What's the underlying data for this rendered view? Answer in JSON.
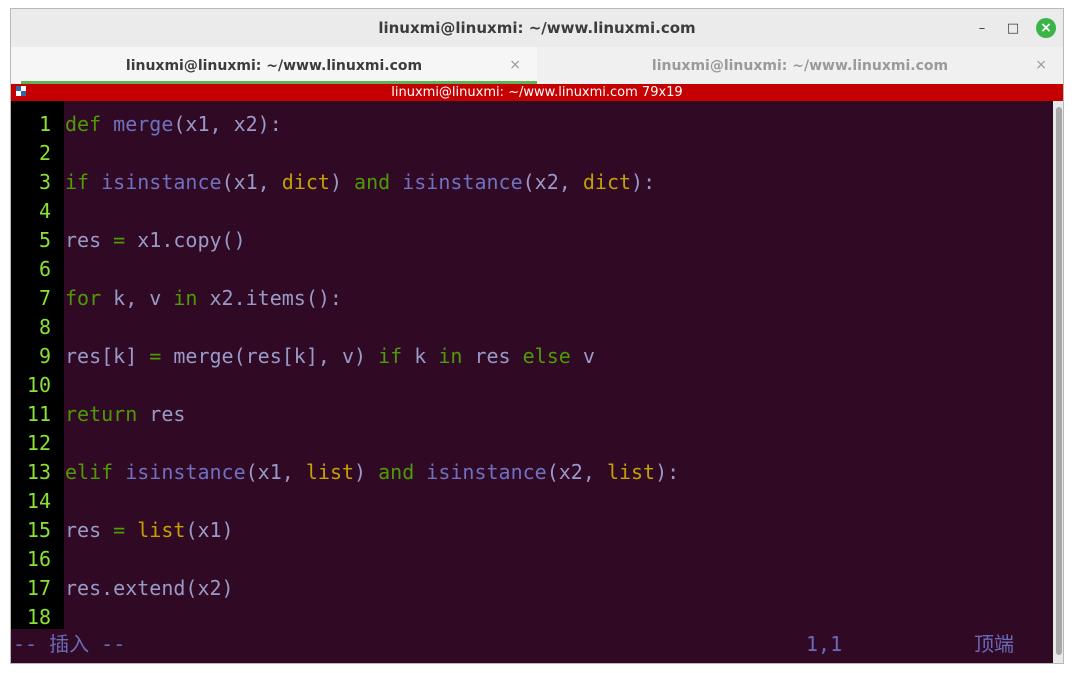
{
  "window": {
    "title": "linuxmi@linuxmi: ~/www.linuxmi.com"
  },
  "window_controls": {
    "minimize": "–",
    "maximize": "□",
    "close": "×"
  },
  "tabs": [
    {
      "label": "linuxmi@linuxmi: ~/www.linuxmi.com",
      "close": "×",
      "active": true
    },
    {
      "label": "linuxmi@linuxmi: ~/www.linuxmi.com",
      "close": "×",
      "active": false
    }
  ],
  "statusline": {
    "text": "linuxmi@linuxmi: ~/www.linuxmi.com 79x19"
  },
  "editor": {
    "lines": [
      {
        "num": "1"
      },
      {
        "num": "2"
      },
      {
        "num": "3"
      },
      {
        "num": "4"
      },
      {
        "num": "5"
      },
      {
        "num": "6"
      },
      {
        "num": "7"
      },
      {
        "num": "8"
      },
      {
        "num": "9"
      },
      {
        "num": "10"
      },
      {
        "num": "11"
      },
      {
        "num": "12"
      },
      {
        "num": "13"
      },
      {
        "num": "14"
      },
      {
        "num": "15"
      },
      {
        "num": "16"
      },
      {
        "num": "17"
      },
      {
        "num": "18"
      }
    ],
    "code": {
      "l1": [
        "def",
        "merge",
        "(x1, x2):"
      ],
      "l3": [
        "if",
        "isinstance",
        "(x1, ",
        "dict",
        ") ",
        "and",
        "isinstance",
        "(x2, ",
        "dict",
        "):"
      ],
      "l5": [
        "res ",
        "=",
        " x1.copy()"
      ],
      "l7": [
        "for",
        " k, v ",
        "in",
        " x2.items():"
      ],
      "l9": [
        "res[k] ",
        "=",
        " merge(res[k], v) ",
        "if",
        " k ",
        "in",
        " res ",
        "else",
        " v"
      ],
      "l11": [
        "return",
        " res"
      ],
      "l13": [
        "elif",
        "isinstance",
        "(x1, ",
        "list",
        ") ",
        "and",
        "isinstance",
        "(x2, ",
        "list",
        "):"
      ],
      "l15": [
        "res ",
        "=",
        " ",
        "list",
        "(x1)"
      ],
      "l17": [
        "res.extend(x2)"
      ]
    }
  },
  "cmdline": {
    "mode": "-- 插入 --",
    "position": "1,1",
    "scroll": "顶端"
  },
  "colors": {
    "terminal_bg": "#300a24",
    "line_number": "#8ae234",
    "keyword": "#4e9a06",
    "builtin": "#c4a000",
    "statusline_bg": "#c40000"
  }
}
